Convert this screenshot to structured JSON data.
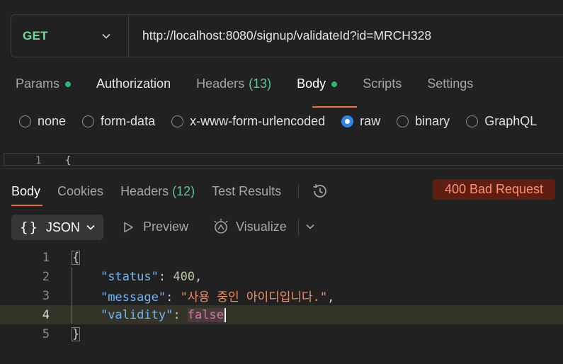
{
  "request": {
    "method": "GET",
    "url": "http://localhost:8080/signup/validateId?id=MRCH328"
  },
  "request_tabs": [
    {
      "label": "Params",
      "dot": true,
      "count": ""
    },
    {
      "label": "Authorization",
      "dot": false,
      "count": ""
    },
    {
      "label": "Headers",
      "dot": false,
      "count": "(13)"
    },
    {
      "label": "Body",
      "dot": true,
      "count": "",
      "active": true
    },
    {
      "label": "Scripts",
      "dot": false,
      "count": ""
    },
    {
      "label": "Settings",
      "dot": false,
      "count": ""
    }
  ],
  "body_types": [
    {
      "label": "none",
      "selected": false
    },
    {
      "label": "form-data",
      "selected": false
    },
    {
      "label": "x-www-form-urlencoded",
      "selected": false
    },
    {
      "label": "raw",
      "selected": true
    },
    {
      "label": "binary",
      "selected": false
    },
    {
      "label": "GraphQL",
      "selected": false
    }
  ],
  "request_editor": {
    "line_number": "1",
    "first_char": "{"
  },
  "response_tabs": [
    {
      "label": "Body",
      "count": "",
      "active": true
    },
    {
      "label": "Cookies",
      "count": ""
    },
    {
      "label": "Headers",
      "count": "(12)"
    },
    {
      "label": "Test Results",
      "count": ""
    }
  ],
  "status": {
    "text": "400 Bad Request",
    "color": "#ff8f73"
  },
  "toolbar": {
    "format_label": "JSON",
    "preview_label": "Preview",
    "visualize_label": "Visualize"
  },
  "response_body": {
    "line_numbers": [
      "1",
      "2",
      "3",
      "4",
      "5"
    ],
    "open_brace": "{",
    "close_brace": "}",
    "lines": [
      {
        "key": "\"status\"",
        "value": "400",
        "trailing": ","
      },
      {
        "key": "\"message\"",
        "value": "\"사용 중인 아이디입니다.\"",
        "trailing": ","
      },
      {
        "key": "\"validity\"",
        "value": "false",
        "trailing": ""
      }
    ]
  },
  "colors": {
    "accent": "#f26b3a",
    "method": "#6bdd9a",
    "radio_selected": "#2f86e9"
  }
}
